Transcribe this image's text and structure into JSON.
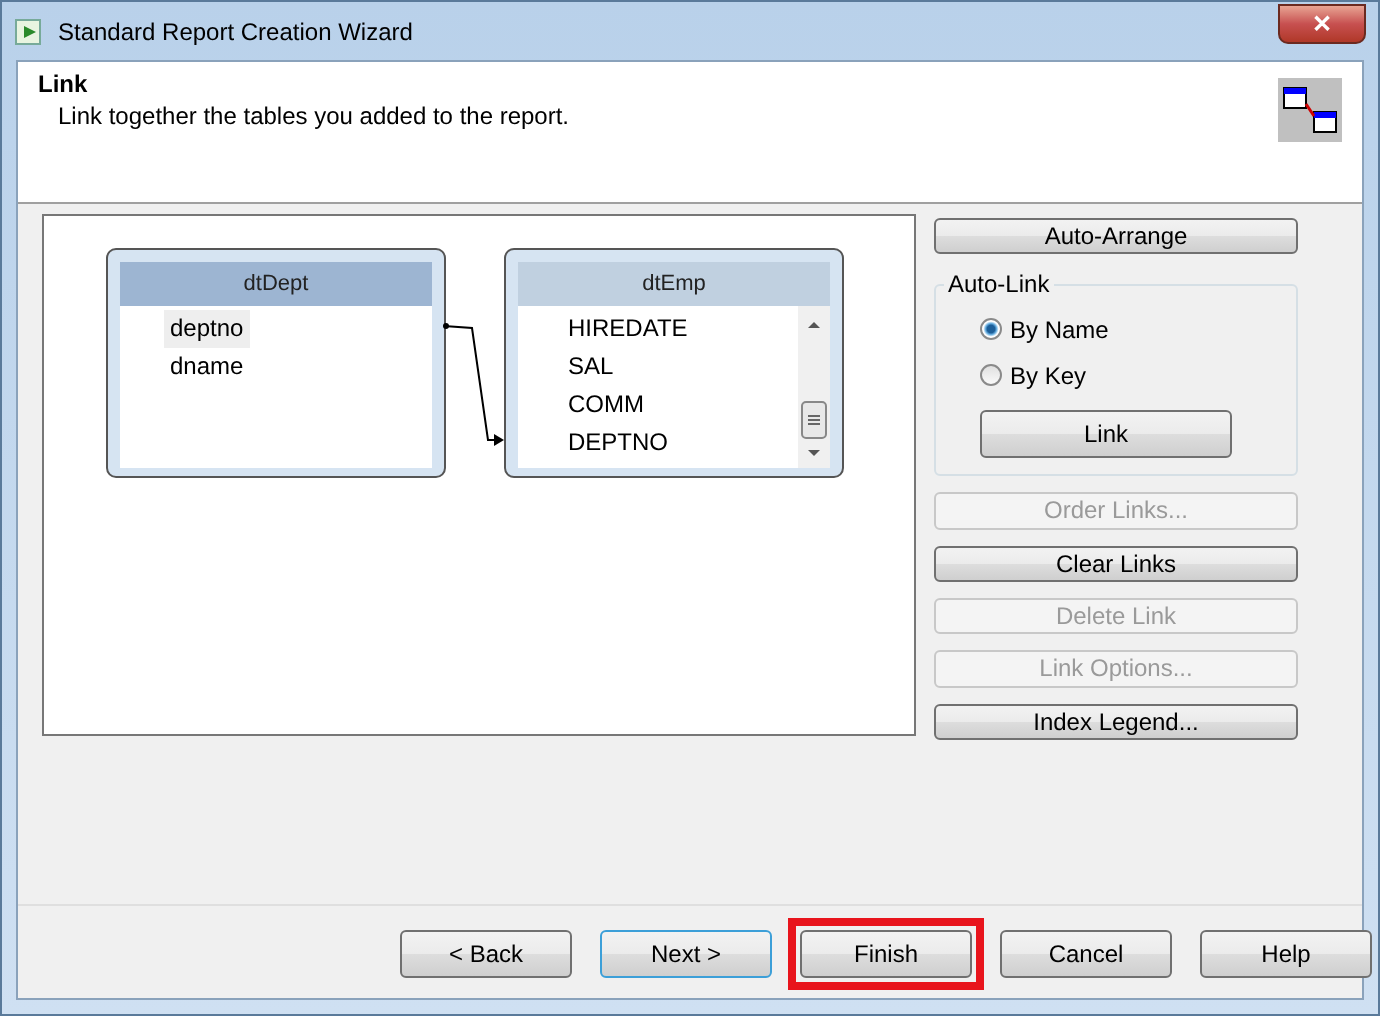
{
  "window": {
    "title": "Standard Report Creation Wizard",
    "close": "✕"
  },
  "header": {
    "title": "Link",
    "subtitle": "Link together the tables you added to the report."
  },
  "tables": [
    {
      "name": "dtDept",
      "selected": true,
      "fields": [
        {
          "label": "deptno",
          "selected": true
        },
        {
          "label": "dname",
          "selected": false
        }
      ]
    },
    {
      "name": "dtEmp",
      "selected": false,
      "fields": [
        {
          "label": "HIREDATE",
          "selected": false
        },
        {
          "label": "SAL",
          "selected": false
        },
        {
          "label": "COMM",
          "selected": false
        },
        {
          "label": "DEPTNO",
          "selected": false
        }
      ]
    }
  ],
  "auto_arrange": {
    "label": "Auto-Arrange",
    "disabled": false
  },
  "auto_link": {
    "title": "Auto-Link",
    "options": [
      {
        "label": "By Name",
        "selected": true
      },
      {
        "label": "By Key",
        "selected": false
      }
    ],
    "button": {
      "label": "Link",
      "disabled": false
    }
  },
  "actions": [
    {
      "label": "Order Links...",
      "disabled": true
    },
    {
      "label": "Clear Links",
      "disabled": false
    },
    {
      "label": "Delete Link",
      "disabled": true
    },
    {
      "label": "Link Options...",
      "disabled": true
    },
    {
      "label": "Index Legend...",
      "disabled": false
    }
  ],
  "footer_buttons": [
    {
      "label": "< Back",
      "default": false,
      "highlighted": false
    },
    {
      "label": "Next >",
      "default": true,
      "highlighted": false
    },
    {
      "label": "Finish",
      "default": false,
      "highlighted": true
    },
    {
      "label": "Cancel",
      "default": false,
      "highlighted": false
    },
    {
      "label": "Help",
      "default": false,
      "highlighted": false
    }
  ]
}
